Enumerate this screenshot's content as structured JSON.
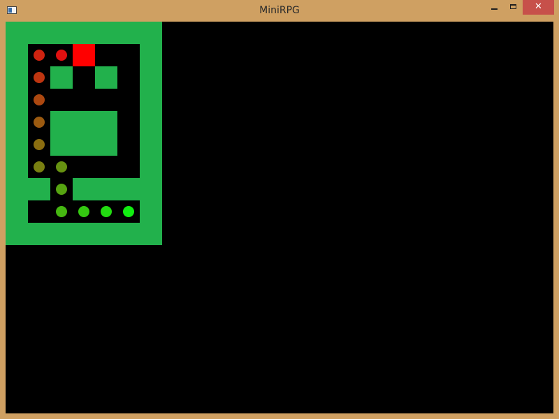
{
  "window": {
    "title": "MiniRPG",
    "icon": "app-window-icon",
    "controls": {
      "minimize_icon": "minimize-icon",
      "maximize_icon": "maximize-icon",
      "close_label": "✕"
    }
  },
  "colors": {
    "frame": "#cfa062",
    "close": "#c7504a",
    "background": "#000000",
    "wall": "#22b14c",
    "player": "#ff0000",
    "path_start": "#e01010",
    "path_end": "#11ee11"
  },
  "map": {
    "cols": 7,
    "rows": 10,
    "grid": [
      "#######",
      "#.....#",
      "#.#.#.#",
      "#.....#",
      "#.###.#",
      "#.###.#",
      "#.....#",
      "##.####",
      "#.....#",
      "#######"
    ],
    "player": {
      "col": 3,
      "row": 1
    },
    "path": [
      {
        "col": 2,
        "row": 1
      },
      {
        "col": 1,
        "row": 1
      },
      {
        "col": 1,
        "row": 2
      },
      {
        "col": 1,
        "row": 3
      },
      {
        "col": 1,
        "row": 4
      },
      {
        "col": 1,
        "row": 5
      },
      {
        "col": 1,
        "row": 6
      },
      {
        "col": 2,
        "row": 6
      },
      {
        "col": 2,
        "row": 7
      },
      {
        "col": 2,
        "row": 8
      },
      {
        "col": 3,
        "row": 8
      },
      {
        "col": 4,
        "row": 8
      },
      {
        "col": 5,
        "row": 8
      }
    ]
  }
}
